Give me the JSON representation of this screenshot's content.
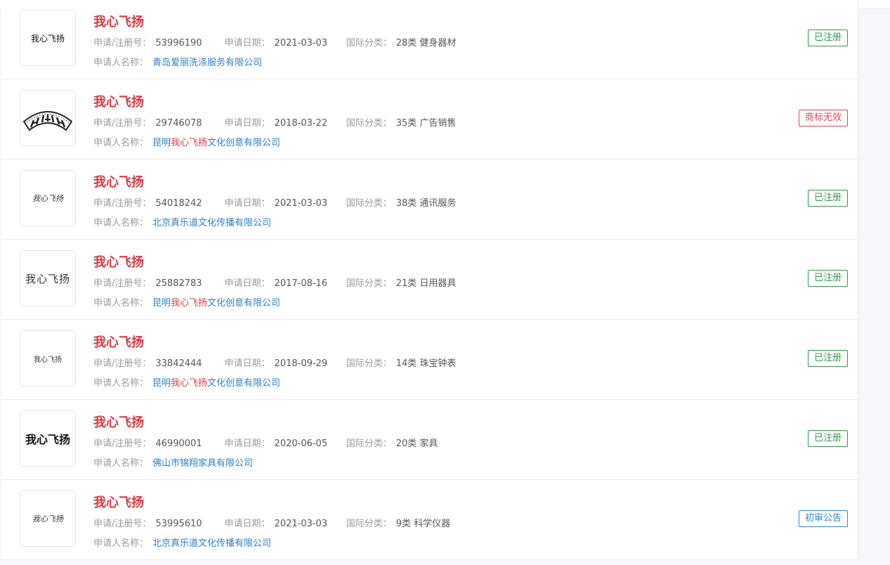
{
  "labels": {
    "reg_no": "申请/注册号：",
    "apply_date": "申请日期：",
    "intl_class": "国际分类：",
    "applicant": "申请人名称："
  },
  "colors": {
    "title_red": "#d83a42",
    "link_blue": "#2b7fc9",
    "status_green": "#2e9a4c",
    "status_red": "#e0424e",
    "status_blue": "#2b87d6"
  },
  "items": [
    {
      "name": "我心飞扬",
      "logo_text": "我心飞扬",
      "reg_no": "53996190",
      "apply_date": "2021-03-03",
      "intl_class": "28类 健身器材",
      "applicant_pre": "青岛爱丽洗涤服务有限公司",
      "applicant_hl": "",
      "applicant_post": "",
      "status": "已注册",
      "status_color": "#2e9a4c"
    },
    {
      "name": "我心飞扬",
      "logo_text": "我心飞扬",
      "reg_no": "29746078",
      "apply_date": "2018-03-22",
      "intl_class": "35类 广告销售",
      "applicant_pre": "昆明",
      "applicant_hl": "我心飞扬",
      "applicant_post": "文化创意有限公司",
      "status": "商标无效",
      "status_color": "#e0424e"
    },
    {
      "name": "我心飞扬",
      "logo_text": "我心飞扬",
      "reg_no": "54018242",
      "apply_date": "2021-03-03",
      "intl_class": "38类 通讯服务",
      "applicant_pre": "北京真乐道文化传播有限公司",
      "applicant_hl": "",
      "applicant_post": "",
      "status": "已注册",
      "status_color": "#2e9a4c"
    },
    {
      "name": "我心飞扬",
      "logo_text": "我心飞扬",
      "reg_no": "25882783",
      "apply_date": "2017-08-16",
      "intl_class": "21类 日用器具",
      "applicant_pre": "昆明",
      "applicant_hl": "我心飞扬",
      "applicant_post": "文化创意有限公司",
      "status": "已注册",
      "status_color": "#2e9a4c"
    },
    {
      "name": "我心飞扬",
      "logo_text": "我心飞扬",
      "reg_no": "33842444",
      "apply_date": "2018-09-29",
      "intl_class": "14类 珠宝钟表",
      "applicant_pre": "昆明",
      "applicant_hl": "我心飞扬",
      "applicant_post": "文化创意有限公司",
      "status": "已注册",
      "status_color": "#2e9a4c"
    },
    {
      "name": "我心飞扬",
      "logo_text": "我心飞扬",
      "reg_no": "46990001",
      "apply_date": "2020-06-05",
      "intl_class": "20类 家具",
      "applicant_pre": "佛山市锦翔家具有限公司",
      "applicant_hl": "",
      "applicant_post": "",
      "status": "已注册",
      "status_color": "#2e9a4c"
    },
    {
      "name": "我心飞扬",
      "logo_text": "我心飞扬",
      "reg_no": "53995610",
      "apply_date": "2021-03-03",
      "intl_class": "9类 科学仪器",
      "applicant_pre": "北京真乐道文化传播有限公司",
      "applicant_hl": "",
      "applicant_post": "",
      "status": "初审公告",
      "status_color": "#2b87d6"
    }
  ]
}
